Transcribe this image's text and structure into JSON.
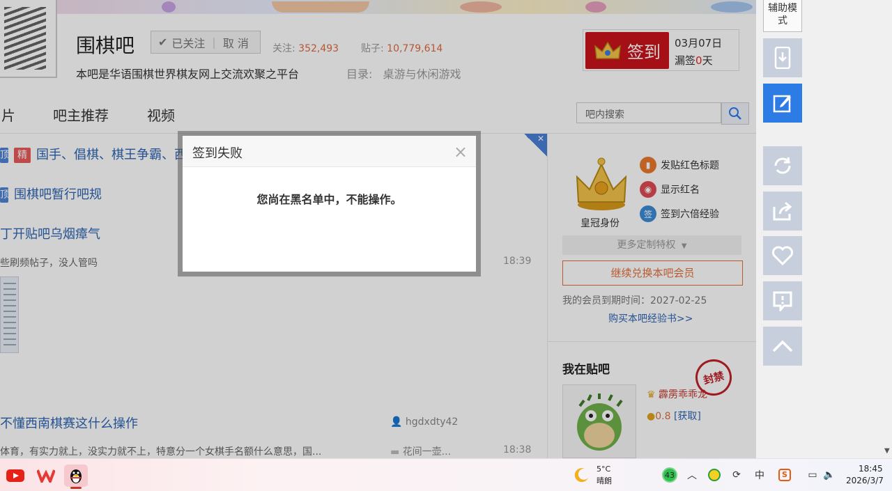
{
  "forum": {
    "name": "围棋吧",
    "follow_label": "已关注",
    "unfollow_label": "取 消",
    "followers_label": "关注:",
    "followers": "352,493",
    "posts_label": "贴子:",
    "posts": "10,779,614",
    "description": "本吧是华语围棋世界棋友网上交流欢聚之平台",
    "catalog_label": "目录:",
    "catalog_value": "桌游与休闲游戏"
  },
  "signin": {
    "button_label": "签到",
    "date": "03月07日",
    "missed_prefix": "漏签",
    "missed_count": "0",
    "missed_suffix": "天"
  },
  "nav": {
    "items": [
      "片",
      "吧主推荐",
      "视频"
    ],
    "search_placeholder": "吧内搜索"
  },
  "threads": [
    {
      "tag1": "顶",
      "tag2": "精",
      "title": "国手、倡棋、棋王争霸、西"
    },
    {
      "tag1": "顶",
      "title": "围棋吧暂行吧规"
    },
    {
      "title": "丁开贴吧乌烟瘴气",
      "excerpt": "些刷频帖子，没人管吗",
      "time": "18:39"
    },
    {
      "title": "不懂西南棋赛这什么操作",
      "excerpt": "体育，有实力就上，没实力就不上，特意分一个女棋手名额什么意思，国...",
      "author": "hgdxdty42",
      "last_reply": "花间一壶...",
      "time": "18:38"
    }
  ],
  "sidebar": {
    "crown_label": "皇冠身份",
    "privileges": [
      {
        "icon": "bookmark-icon",
        "label": "发贴红色标题"
      },
      {
        "icon": "chat-icon",
        "label": "显示红名"
      },
      {
        "icon": "sign-badge-icon",
        "badge": "签",
        "label": "签到六倍经验"
      }
    ],
    "more_privileges": "更多定制特权",
    "exchange_button": "继续兑换本吧会员",
    "expire_label": "我的会员到期时间：2027-02-25",
    "buy_link": "购买本吧经验书>>",
    "me_title": "我在贴吧",
    "me_name": "霹雳乖乖龙",
    "me_level": "0.8",
    "me_get": "[获取]",
    "stamp": "封禁"
  },
  "side_rail": {
    "assist_mode": "辅助模式"
  },
  "modal": {
    "title": "签到失败",
    "message": "您尚在黑名单中，不能操作。",
    "close": "×"
  },
  "taskbar": {
    "weather_temp": "5°C",
    "weather_desc": "晴朗",
    "badge_count": "43",
    "ime": "中",
    "time": "18:45",
    "date": "2026/3/7"
  },
  "colors": {
    "accent": "#2d7be5",
    "signin_red": "#c8141b",
    "link_blue": "#2d64b3",
    "orange": "#e0703a"
  }
}
